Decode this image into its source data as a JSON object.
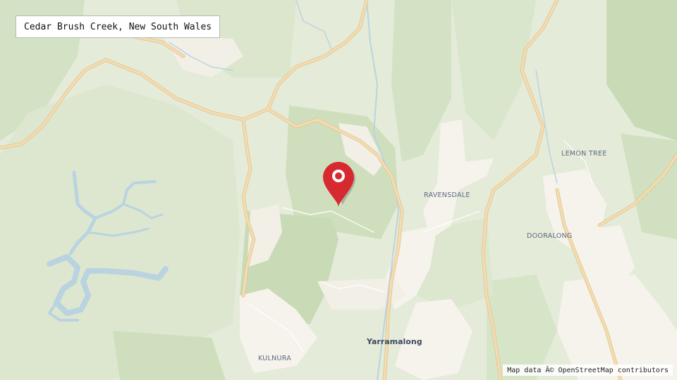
{
  "title": "Cedar Brush Creek, New South Wales",
  "places": {
    "lemon_tree": "LEMON TREE",
    "ravensdale": "RAVENSDALE",
    "dooralong": "DOORALONG",
    "yarramalong": "Yarramalong",
    "kulnura": "KULNURA"
  },
  "marker": {
    "icon": "map-pin-icon",
    "color": "#d62a30"
  },
  "attribution": "Map data Â© OpenStreetMap contributors",
  "colors": {
    "land": "#e4ebd9",
    "forest": "#d3e2c4",
    "forest_dark": "#c8dab6",
    "settlement": "#f6f3ec",
    "road": "#f3ddb8",
    "road_edge": "#e6c88e",
    "water": "#b9d4e0"
  }
}
